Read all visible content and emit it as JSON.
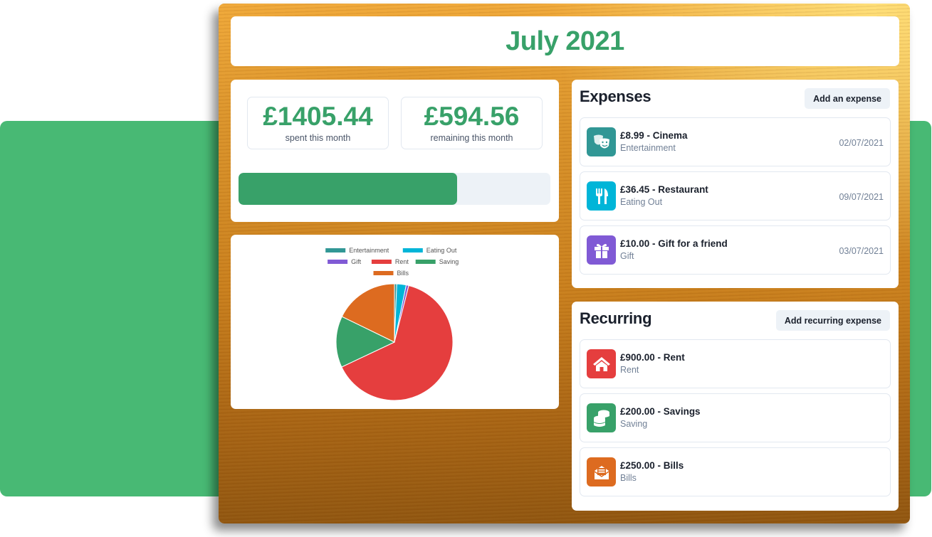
{
  "header": {
    "title": "July 2021"
  },
  "summary": {
    "spent_amount": "£1405.44",
    "spent_label": "spent this month",
    "remaining_amount": "£594.56",
    "remaining_label": "remaining this month",
    "progress_fraction": 0.7
  },
  "chart_data": {
    "type": "pie",
    "legend_position": "top",
    "categories": [
      "Entertainment",
      "Eating Out",
      "Gift",
      "Rent",
      "Saving",
      "Bills"
    ],
    "values": [
      8.99,
      36.45,
      10.0,
      900.0,
      200.0,
      250.0
    ],
    "colors": [
      "#319795",
      "#00b5d8",
      "#805ad5",
      "#e53e3e",
      "#38a169",
      "#dd6b20"
    ]
  },
  "expenses": {
    "title": "Expenses",
    "add_label": "Add an expense",
    "items": [
      {
        "title": "£8.99 - Cinema",
        "category": "Entertainment",
        "date": "02/07/2021",
        "icon": "theater-masks-icon",
        "color": "#319795"
      },
      {
        "title": "£36.45 - Restaurant",
        "category": "Eating Out",
        "date": "09/07/2021",
        "icon": "utensils-icon",
        "color": "#00b5d8"
      },
      {
        "title": "£10.00 - Gift for a friend",
        "category": "Gift",
        "date": "03/07/2021",
        "icon": "gift-icon",
        "color": "#805ad5"
      }
    ]
  },
  "recurring": {
    "title": "Recurring",
    "add_label": "Add recurring expense",
    "items": [
      {
        "title": "£900.00 - Rent",
        "category": "Rent",
        "icon": "home-icon",
        "color": "#e53e3e"
      },
      {
        "title": "£200.00 - Savings",
        "category": "Saving",
        "icon": "coins-icon",
        "color": "#38a169"
      },
      {
        "title": "£250.00 - Bills",
        "category": "Bills",
        "icon": "envelope-bill-icon",
        "color": "#dd6b20"
      }
    ]
  }
}
